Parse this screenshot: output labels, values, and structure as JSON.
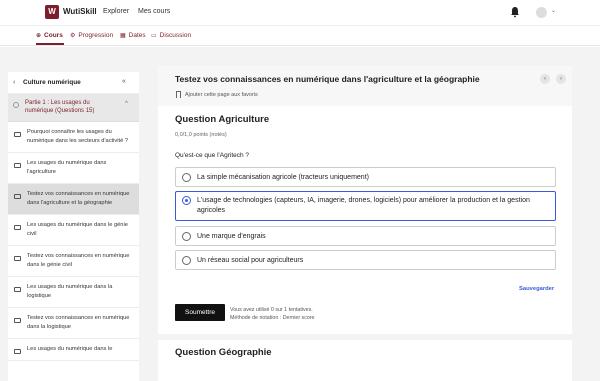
{
  "header": {
    "logo_letter": "W",
    "brand": "WutiSkill",
    "nav": [
      "Explorer",
      "Mes cours"
    ],
    "icons": [
      "bell-icon",
      "user-avatar-icon",
      "chevron-down-icon"
    ]
  },
  "tabs": [
    {
      "label": "Cours",
      "icon": "book-icon",
      "active": true
    },
    {
      "label": "Progression",
      "icon": "gear-icon",
      "active": false
    },
    {
      "label": "Dates",
      "icon": "calendar-icon",
      "active": false
    },
    {
      "label": "Discussion",
      "icon": "chat-icon",
      "active": false
    }
  ],
  "sidebar": {
    "title": "Culture numérique",
    "section": "Partie 1 : Les usages du numérique (Questions 15)",
    "items": [
      {
        "label": "Pourquoi connaître les usages du numérique dans les secteurs d'activité ?",
        "active": false
      },
      {
        "label": "Les usages du numérique dans l'agriculture",
        "active": false
      },
      {
        "label": "Testez vos connaissances en numérique dans l'agriculture et la géographie",
        "active": true
      },
      {
        "label": "Les usages du numérique dans le génie civil",
        "active": false
      },
      {
        "label": "Testez vos connaissances en numérique dans le génie civil",
        "active": false
      },
      {
        "label": "Les usages du numérique dans la logistique",
        "active": false
      },
      {
        "label": "Testez vos connaissances en numérique dans la logistique",
        "active": false
      },
      {
        "label": "Les usages du numérique dans le",
        "active": false
      }
    ]
  },
  "main": {
    "title": "Testez vos connaissances en numérique dans l'agriculture et la géographie",
    "bookmark": "Ajouter cette page aux favoris",
    "question1": {
      "title": "Question Agriculture",
      "points": "0,0/1,0 points (notés)",
      "prompt": "Qu'est-ce que l'Agritech ?",
      "options": [
        {
          "text": "La simple mécanisation agricole (tracteurs uniquement)",
          "selected": false
        },
        {
          "text": "L'usage de technologies (capteurs, IA, imagerie, drones, logiciels) pour améliorer la production et la gestion agricoles",
          "selected": true
        },
        {
          "text": "Une marque d'engrais",
          "selected": false
        },
        {
          "text": "Un réseau social pour agriculteurs",
          "selected": false
        }
      ],
      "save_label": "Sauvegarder",
      "submit_label": "Soumettre",
      "attempts_line1": "Vous avez utilisé 0 sur 1 tentatives.",
      "attempts_line2": "Méthode de notation : Dernier score"
    },
    "question2": {
      "title": "Question Géographie"
    }
  },
  "colors": {
    "brand": "#7a1f2b",
    "accent": "#3b5bdb",
    "background": "#f3f3f3"
  }
}
